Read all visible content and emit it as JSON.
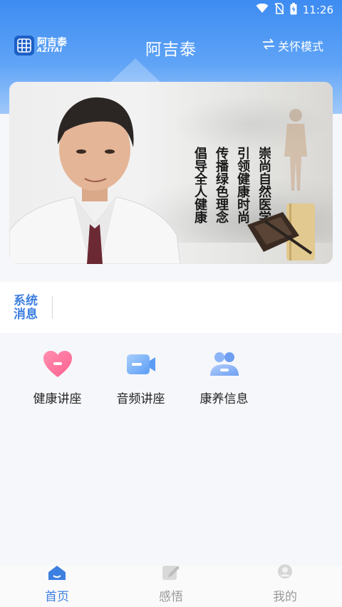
{
  "status_bar": {
    "time": "11:26",
    "icons": [
      "wifi-icon",
      "no-sim-icon",
      "battery-charging-icon"
    ]
  },
  "header": {
    "logo": {
      "cn": "阿吉泰",
      "en": "AZITAI"
    },
    "title": "阿吉泰",
    "care_mode_label": "关怀模式",
    "care_mode_icon": "swap-arrows-icon"
  },
  "banner": {
    "poem_columns": [
      "崇尚自然医学",
      "引领健康时尚",
      "传播绿色理念",
      "倡导全人健康"
    ]
  },
  "notice": {
    "label_line1": "系统",
    "label_line2": "消息",
    "text": ""
  },
  "entries": [
    {
      "label": "健康讲座",
      "icon": "heart-icon"
    },
    {
      "label": "音频讲座",
      "icon": "video-camera-icon"
    },
    {
      "label": "康养信息",
      "icon": "people-icon"
    }
  ],
  "tabbar": {
    "tabs": [
      {
        "label": "首页",
        "icon": "home-icon",
        "active": true
      },
      {
        "label": "感悟",
        "icon": "edit-note-icon",
        "active": false
      },
      {
        "label": "我的",
        "icon": "user-icon",
        "active": false
      }
    ]
  },
  "colors": {
    "primary": "#3d7fe0",
    "header_gradient_top": "#3d8cf2",
    "inactive": "#999999"
  }
}
